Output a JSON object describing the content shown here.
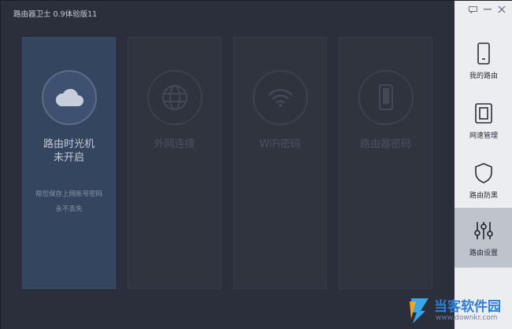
{
  "window": {
    "title": "路由器卫士 0.9体验版11"
  },
  "cards": [
    {
      "label": "路由时光机",
      "label2": "未开启",
      "desc1": "帮您保存上网账号密码",
      "desc2": "永不丢失",
      "icon": "cloud-icon",
      "active": true
    },
    {
      "label": "外网连接",
      "icon": "globe-icon",
      "active": false
    },
    {
      "label": "WiFi密码",
      "icon": "wifi-icon",
      "active": false
    },
    {
      "label": "路由器密码",
      "icon": "phone-icon",
      "active": false
    }
  ],
  "sidebar": {
    "items": [
      {
        "label": "我的路由",
        "icon": "router-icon"
      },
      {
        "label": "网速管理",
        "icon": "speed-icon"
      },
      {
        "label": "路由防黑",
        "icon": "shield-icon"
      },
      {
        "label": "路由设置",
        "icon": "sliders-icon"
      }
    ],
    "active_index": 3
  },
  "watermark": {
    "text": "当客软件园",
    "url": "www.downkr.com"
  },
  "colors": {
    "background": "#2b2f3b",
    "active_card": "#33455f",
    "sidebar": "#ebedf0",
    "sidebar_active": "#bfc4cc"
  }
}
